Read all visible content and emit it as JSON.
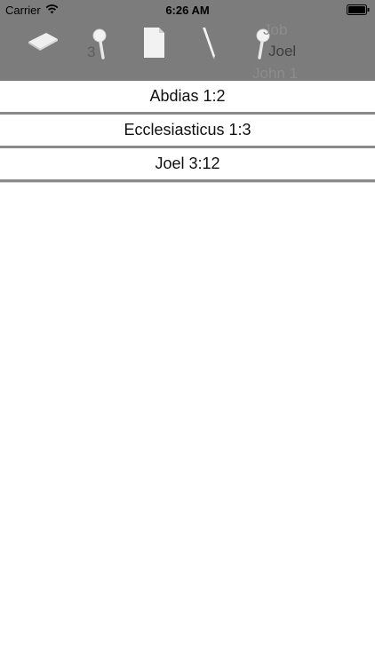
{
  "statusbar": {
    "carrier": "Carrier",
    "time": "6:26 AM"
  },
  "toolbar": {
    "icons": [
      "book-icon",
      "magnifier-icon",
      "page-icon",
      "pen-icon",
      "magnifier-icon"
    ],
    "picker_number": "3",
    "picker_books": {
      "previous": "Job",
      "current": "Joel",
      "next": "John 1"
    }
  },
  "bookmarks": [
    {
      "label": "Abdias  1:2"
    },
    {
      "label": "Ecclesiasticus  1:3"
    },
    {
      "label": "Joel  3:12"
    }
  ]
}
